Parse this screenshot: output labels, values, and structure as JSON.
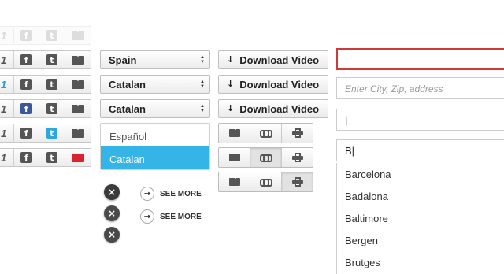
{
  "share_rows": [
    {
      "count": "1",
      "state": "faded",
      "fb": "f",
      "tw": "t",
      "active": ""
    },
    {
      "count": "1",
      "state": "normal",
      "fb": "f",
      "tw": "t",
      "active": ""
    },
    {
      "count": "1",
      "state": "count-hover",
      "fb": "f",
      "tw": "t",
      "active": "count"
    },
    {
      "count": "1",
      "state": "fb-hover",
      "fb": "f",
      "tw": "t",
      "active": "facebook"
    },
    {
      "count": "1",
      "state": "tw-hover",
      "fb": "f",
      "tw": "t",
      "active": "twitter"
    },
    {
      "count": "1",
      "state": "mail-hover",
      "fb": "f",
      "tw": "t",
      "active": "mail"
    }
  ],
  "selects": {
    "first": "Spain",
    "second": "Catalan",
    "third": "Catalan",
    "options": [
      "Español",
      "Catalan"
    ],
    "selected_option": "Catalan"
  },
  "dismiss_icon": "×",
  "see_more": {
    "label": "SEE MORE",
    "icon": "→"
  },
  "download": {
    "label": "Download Video",
    "icon": "↓"
  },
  "action_groups_count": 3,
  "fields": {
    "empty_error_value": "",
    "placeholder": "Enter City, Zip, address",
    "typing_value": "|",
    "autocomplete_value": "B|"
  },
  "suggestions": [
    "Barcelona",
    "Badalona",
    "Baltimore",
    "Bergen",
    "Brutges"
  ],
  "colors": {
    "accent_blue": "#35b4e8",
    "facebook": "#3b5998",
    "twitter": "#2ca7e0",
    "mail_active": "#d9232f",
    "error": "#d33838"
  }
}
